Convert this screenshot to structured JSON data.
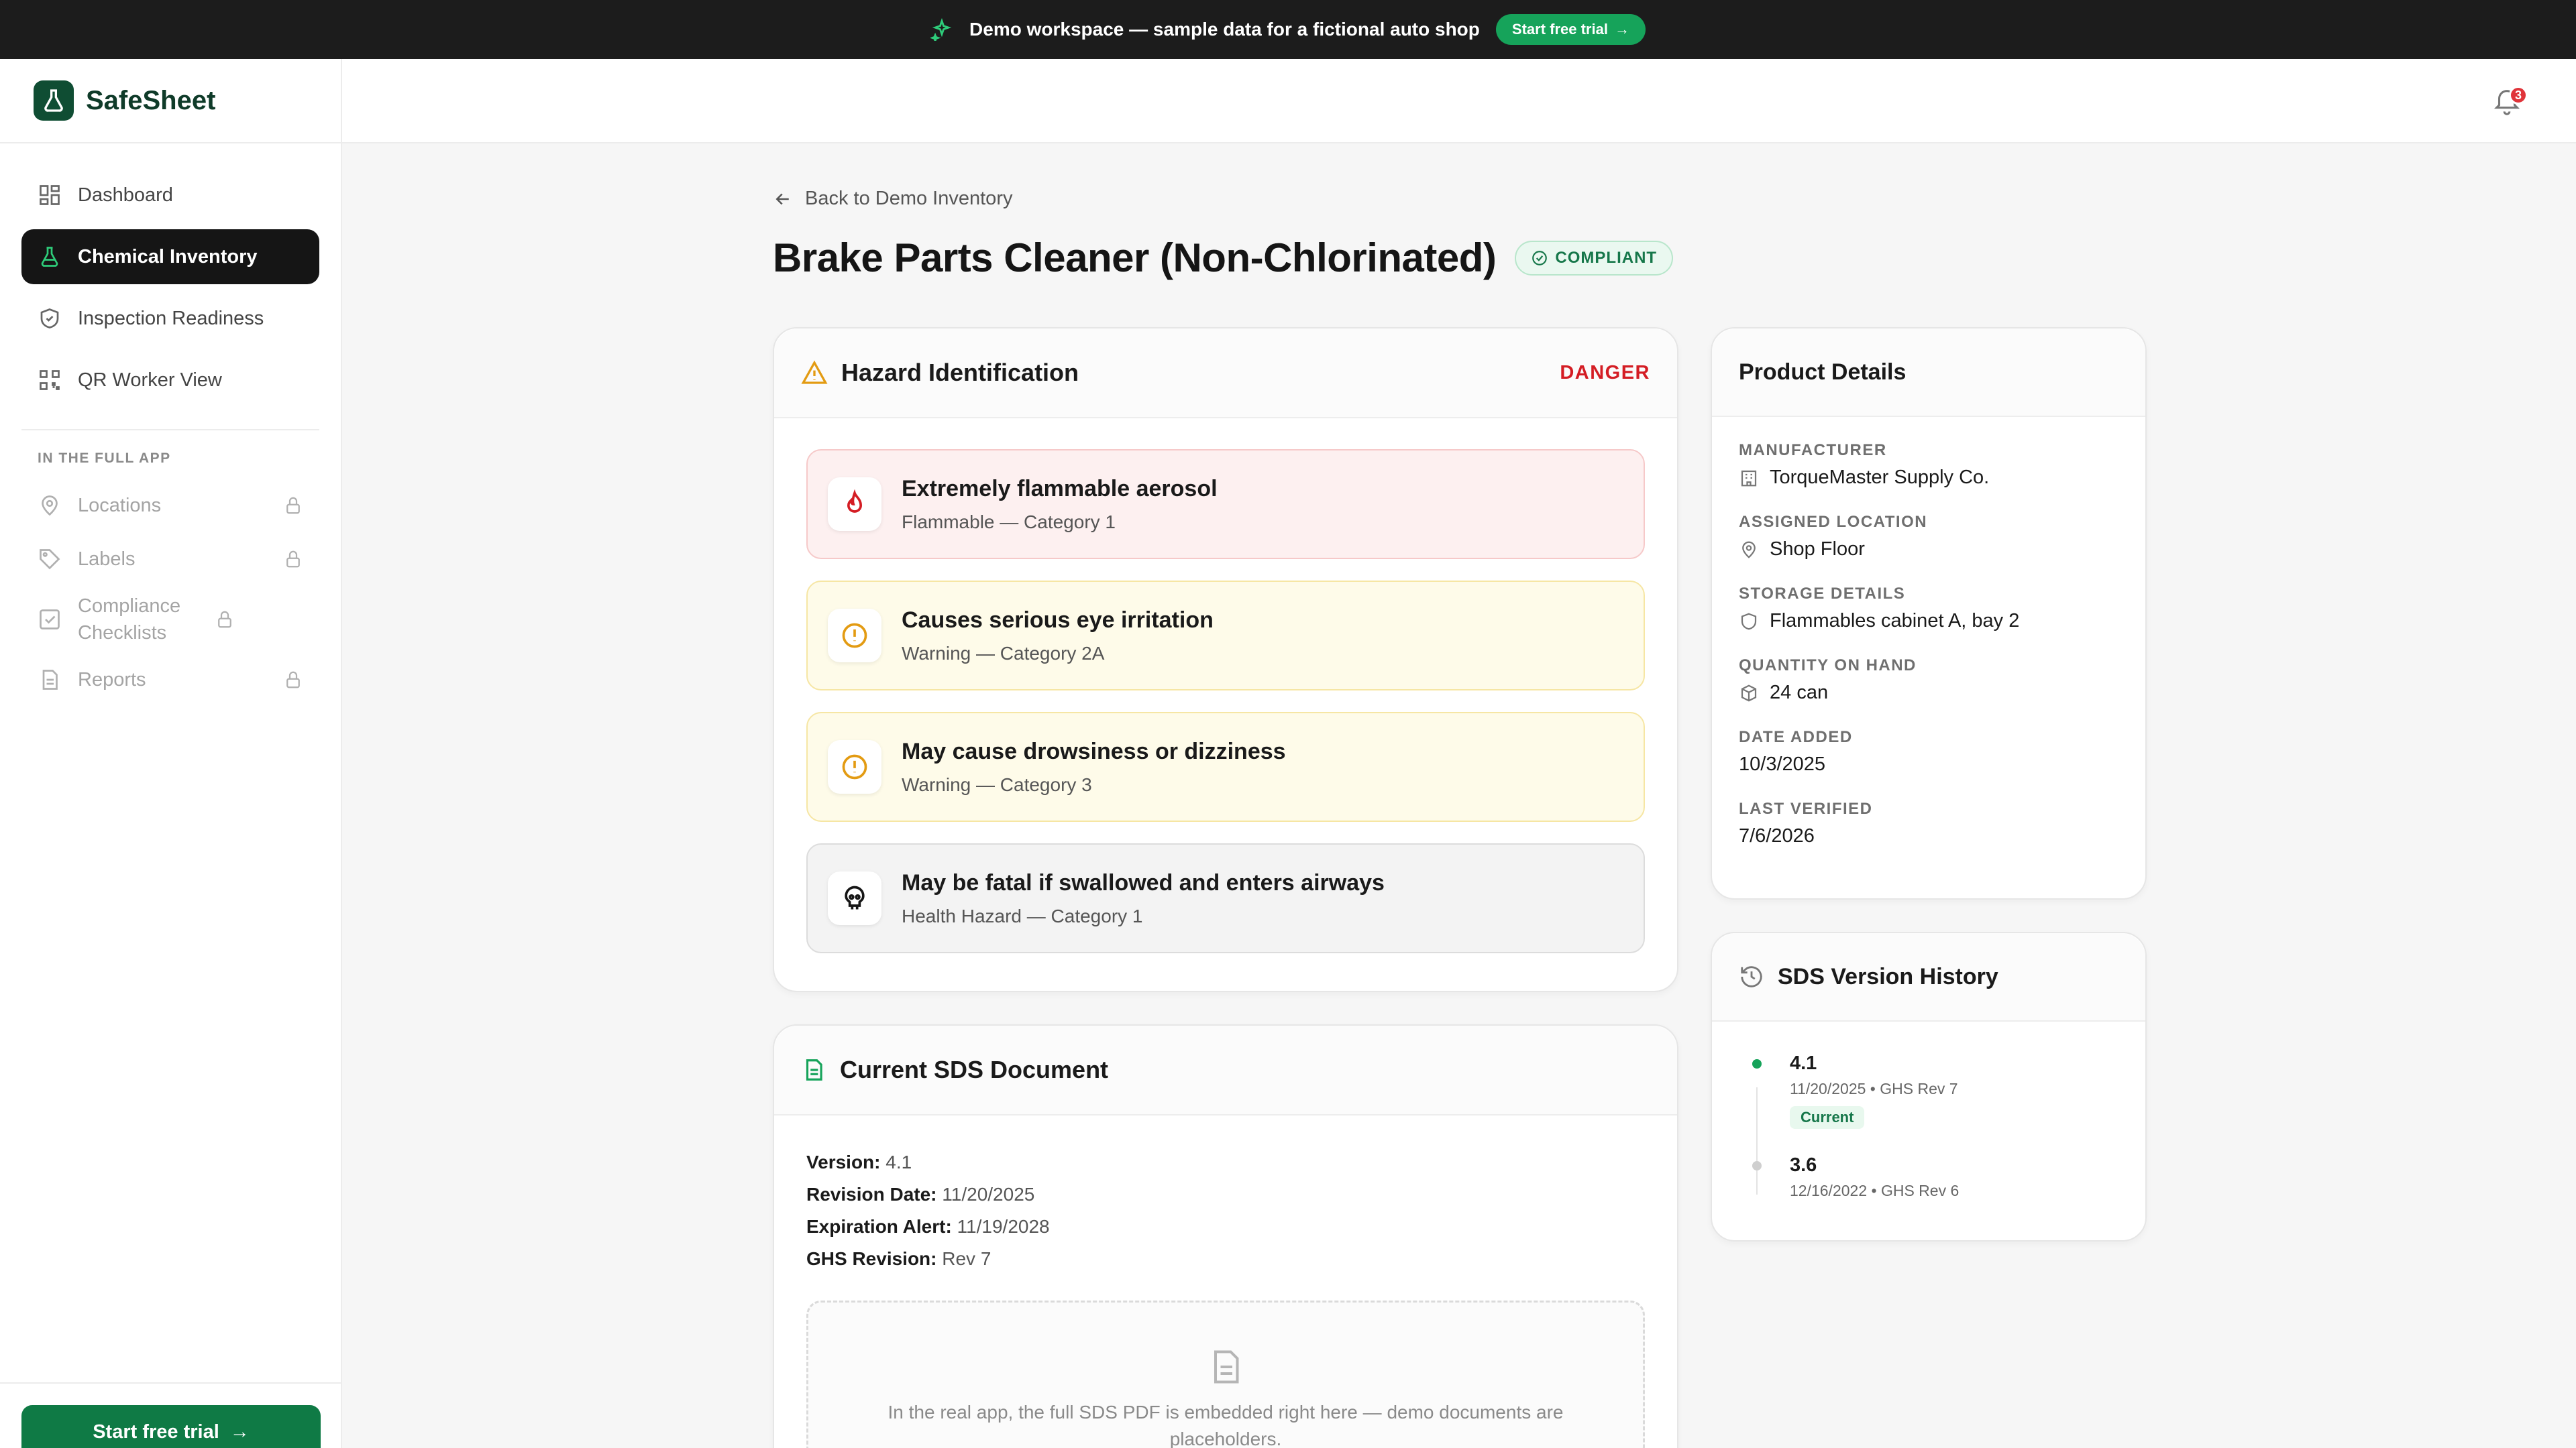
{
  "banner": {
    "text": "Demo workspace — sample data for a fictional auto shop",
    "cta_label": "Start free trial"
  },
  "brand": {
    "name": "SafeSheet"
  },
  "sidebar": {
    "items": [
      {
        "label": "Dashboard",
        "icon": "grid-icon"
      },
      {
        "label": "Chemical Inventory",
        "icon": "flask-icon",
        "active": true
      },
      {
        "label": "Inspection Readiness",
        "icon": "shield-icon"
      },
      {
        "label": "QR Worker View",
        "icon": "qr-icon"
      }
    ],
    "section_label": "IN THE FULL APP",
    "locked_items": [
      {
        "label": "Locations",
        "icon": "pin-icon"
      },
      {
        "label": "Labels",
        "icon": "tag-icon"
      },
      {
        "label": "Compliance Checklists",
        "icon": "checklist-icon"
      },
      {
        "label": "Reports",
        "icon": "report-icon"
      }
    ],
    "trial_label": "Start free trial"
  },
  "topbar": {
    "notification_count": "3"
  },
  "page": {
    "back_label": "Back to Demo Inventory",
    "title": "Brake Parts Cleaner (Non-Chlorinated)",
    "status": "COMPLIANT"
  },
  "hazard": {
    "title": "Hazard Identification",
    "signal_word": "DANGER",
    "items": [
      {
        "title": "Extremely flammable aerosol",
        "sub": "Flammable — Category 1",
        "tone": "red",
        "icon": "flame-icon"
      },
      {
        "title": "Causes serious eye irritation",
        "sub": "Warning — Category 2A",
        "tone": "amber",
        "icon": "exclamation-icon"
      },
      {
        "title": "May cause drowsiness or dizziness",
        "sub": "Warning — Category 3",
        "tone": "amber",
        "icon": "exclamation-icon"
      },
      {
        "title": "May be fatal if swallowed and enters airways",
        "sub": "Health Hazard — Category 1",
        "tone": "gray",
        "icon": "skull-icon"
      }
    ]
  },
  "sds": {
    "title": "Current SDS Document",
    "fields": [
      {
        "label": "Version:",
        "value": "4.1"
      },
      {
        "label": "Revision Date:",
        "value": "11/20/2025"
      },
      {
        "label": "Expiration Alert:",
        "value": "11/19/2028"
      },
      {
        "label": "GHS Revision:",
        "value": "Rev 7"
      }
    ],
    "placeholder": "In the real app, the full SDS PDF is embedded right here — demo documents are placeholders."
  },
  "product": {
    "title": "Product Details",
    "fields": [
      {
        "label": "MANUFACTURER",
        "value": "TorqueMaster Supply Co.",
        "icon": "building-icon"
      },
      {
        "label": "ASSIGNED LOCATION",
        "value": "Shop Floor",
        "icon": "pin-icon"
      },
      {
        "label": "STORAGE DETAILS",
        "value": "Flammables cabinet A, bay 2",
        "icon": "shield-icon"
      },
      {
        "label": "QUANTITY ON HAND",
        "value": "24 can",
        "icon": "box-icon"
      },
      {
        "label": "DATE ADDED",
        "value": "10/3/2025",
        "icon": ""
      },
      {
        "label": "LAST VERIFIED",
        "value": "7/6/2026",
        "icon": ""
      }
    ]
  },
  "history": {
    "title": "SDS Version History",
    "versions": [
      {
        "version": "4.1",
        "meta": "11/20/2025 • GHS Rev 7",
        "current_label": "Current"
      },
      {
        "version": "3.6",
        "meta": "12/16/2022 • GHS Rev 6",
        "current_label": ""
      }
    ]
  },
  "colors": {
    "accent": "#16a35a",
    "danger": "#d41d24",
    "brand": "#0f4d33"
  }
}
